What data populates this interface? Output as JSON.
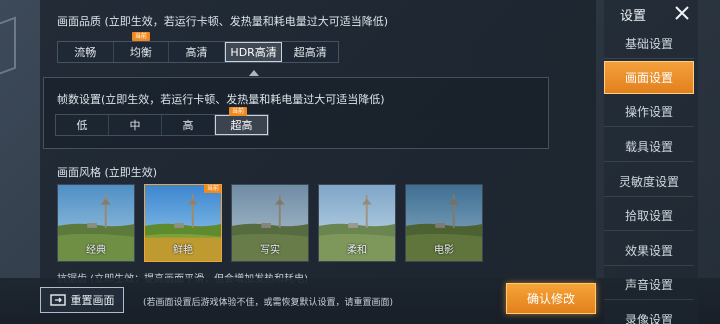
{
  "quality": {
    "title": "画面品质 (立即生效，若运行卡顿、发热量和耗电量过大可适当降低)",
    "options": [
      "流畅",
      "均衡",
      "高清",
      "HDR高清",
      "超高清"
    ],
    "selected": "HDR高清",
    "current_badge": "当前"
  },
  "fps": {
    "title": "帧数设置(立即生效，若运行卡顿、发热量和耗电量过大可适当降低)",
    "options": [
      "低",
      "中",
      "高",
      "超高"
    ],
    "selected": "超高",
    "current_badge": "当前"
  },
  "style": {
    "title": "画面风格 (立即生效)",
    "options": [
      "经典",
      "鲜艳",
      "写实",
      "柔和",
      "电影"
    ],
    "selected": "鲜艳",
    "current_badge": "当前"
  },
  "partially_visible_text": "抗锯齿 (立即生效：提高画面平滑，但会增加发热和耗电)",
  "bottom": {
    "reset_label": "重置画面",
    "hint": "(若画面设置后游戏体验不佳，或需恢复默认设置，请重置画面)",
    "confirm_label": "确认修改"
  },
  "sidebar": {
    "title": "设置",
    "items": [
      "基础设置",
      "画面设置",
      "操作设置",
      "载具设置",
      "灵敏度设置",
      "拾取设置",
      "效果设置",
      "声音设置",
      "录像设置"
    ],
    "active": "画面设置"
  },
  "icons": {
    "close": "close-icon",
    "reset": "reset-screen-icon"
  },
  "colors": {
    "accent": "#f0962c",
    "panel": "#1c2530"
  }
}
